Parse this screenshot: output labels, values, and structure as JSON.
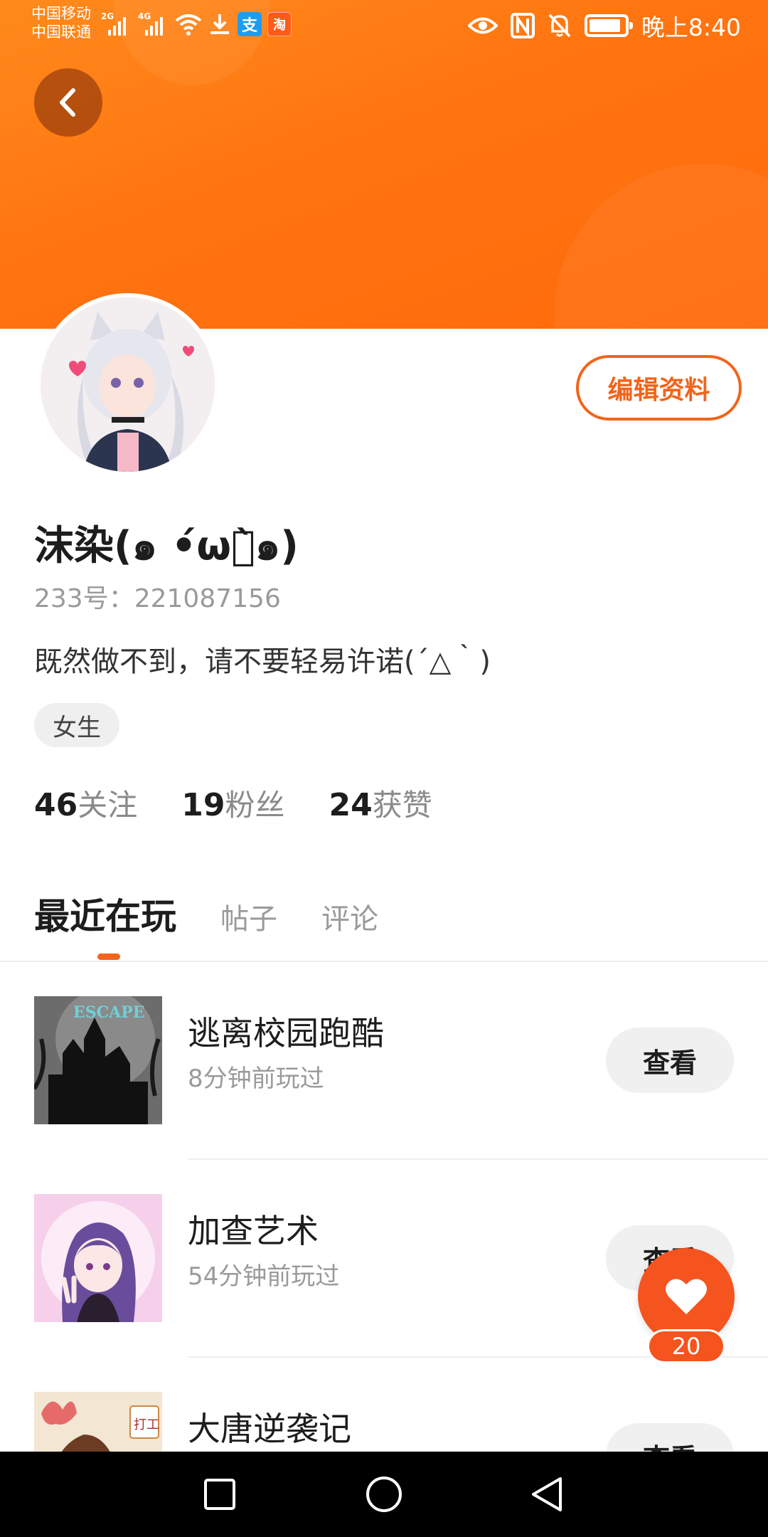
{
  "status_bar": {
    "carrier_1": "中国移动",
    "carrier_2": "中国联通",
    "sim1_network": "2G",
    "sim2_network": "4G",
    "alipay_glyph": "支",
    "taobao_glyph": "淘",
    "time": "晚上8:40",
    "battery_level": 0.9,
    "icons": [
      "signal-icon",
      "wifi-icon",
      "download-icon",
      "alipay-icon",
      "taobao-icon",
      "eye-icon",
      "nfc-icon",
      "bell-off-icon",
      "battery-icon"
    ]
  },
  "header": {
    "back_icon": "chevron-left-icon",
    "accent_color": "#ff7410"
  },
  "profile": {
    "nickname": "沫染(๑ •́ωก̀๑)",
    "uid": "233号：221087156",
    "bio": "既然做不到，请不要轻易许诺(´△｀)",
    "gender_tag": "女生",
    "edit_button": "编辑资料",
    "stats": [
      {
        "num": "46",
        "label": "关注"
      },
      {
        "num": "19",
        "label": "粉丝"
      },
      {
        "num": "24",
        "label": "获赞"
      }
    ]
  },
  "tabs": [
    {
      "label": "最近在玩",
      "active": true
    },
    {
      "label": "帖子",
      "active": false
    },
    {
      "label": "评论",
      "active": false
    }
  ],
  "games": [
    {
      "title": "逃离校园跑酷",
      "time": "8分钟前玩过",
      "button": "查看"
    },
    {
      "title": "加查艺术",
      "time": "54分钟前玩过",
      "button": "查看"
    },
    {
      "title": "大唐逆袭记",
      "time": "",
      "button": "查看"
    }
  ],
  "thumb_texts": {
    "game1": "ESCAPE",
    "game3": "打工"
  },
  "like": {
    "count": "20",
    "icon": "heart-icon"
  },
  "nav": {
    "icons": [
      "square-icon",
      "circle-icon",
      "triangle-back-icon"
    ]
  },
  "colors": {
    "accent": "#f2641b",
    "like": "#f5541e"
  }
}
